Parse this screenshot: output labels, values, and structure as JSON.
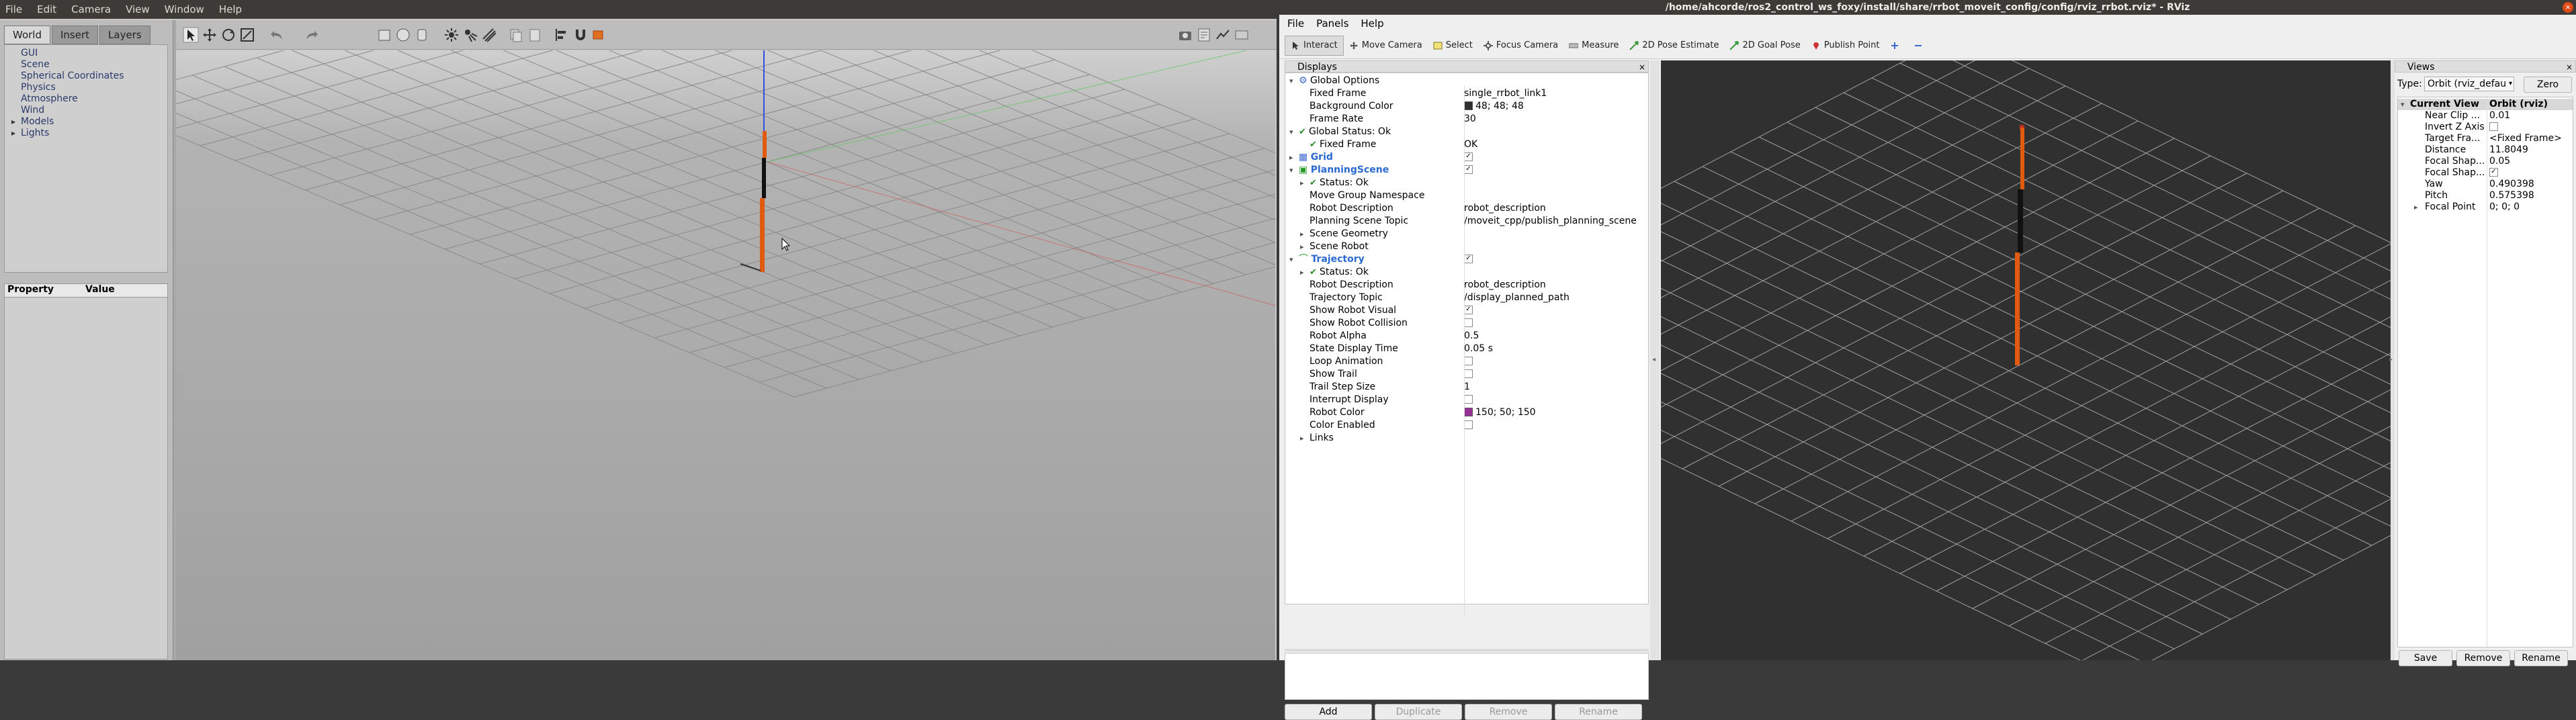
{
  "gazebo": {
    "menu": [
      "File",
      "Edit",
      "Camera",
      "View",
      "Window",
      "Help"
    ],
    "tabs": [
      "World",
      "Insert",
      "Layers"
    ],
    "tree_items": [
      {
        "label": "GUI",
        "expandable": false
      },
      {
        "label": "Scene",
        "expandable": false
      },
      {
        "label": "Spherical Coordinates",
        "expandable": false
      },
      {
        "label": "Physics",
        "expandable": false
      },
      {
        "label": "Atmosphere",
        "expandable": false
      },
      {
        "label": "Wind",
        "expandable": false
      },
      {
        "label": "Models",
        "expandable": true
      },
      {
        "label": "Lights",
        "expandable": true
      }
    ],
    "property_header": {
      "property": "Property",
      "value": "Value"
    }
  },
  "rviz": {
    "title": "/home/ahcorde/ros2_control_ws_foxy/install/share/rrbot_moveit_config/config/rviz_rrbot.rviz* - RViz",
    "menu": [
      "File",
      "Panels",
      "Help"
    ],
    "tools": [
      {
        "label": "Interact",
        "icon": "interact-icon",
        "active": true
      },
      {
        "label": "Move Camera",
        "icon": "move-camera-icon",
        "active": false
      },
      {
        "label": "Select",
        "icon": "select-icon",
        "active": false
      },
      {
        "label": "Focus Camera",
        "icon": "focus-camera-icon",
        "active": false
      },
      {
        "label": "Measure",
        "icon": "measure-icon",
        "active": false
      },
      {
        "label": "2D Pose Estimate",
        "icon": "pose-estimate-icon",
        "active": false
      },
      {
        "label": "2D Goal Pose",
        "icon": "goal-pose-icon",
        "active": false
      },
      {
        "label": "Publish Point",
        "icon": "publish-point-icon",
        "active": false
      }
    ],
    "displays": {
      "title": "Displays",
      "rows": [
        {
          "indent": 0,
          "expander": "▾",
          "icon": "gear",
          "label": "Global Options",
          "value": ""
        },
        {
          "indent": 1,
          "label": "Fixed Frame",
          "value": "single_rrbot_link1"
        },
        {
          "indent": 1,
          "label": "Background Color",
          "value": "48; 48; 48",
          "swatch": "#303030"
        },
        {
          "indent": 1,
          "label": "Frame Rate",
          "value": "30"
        },
        {
          "indent": 0,
          "expander": "▾",
          "tick": true,
          "label": "Global Status: Ok",
          "value": ""
        },
        {
          "indent": 1,
          "tick": true,
          "label": "Fixed Frame",
          "value": "OK"
        },
        {
          "indent": 0,
          "expander": "▸",
          "icon": "grid",
          "label": "Grid",
          "value": "",
          "check": true,
          "highlight": true
        },
        {
          "indent": 0,
          "expander": "▾",
          "icon": "scene",
          "label": "PlanningScene",
          "value": "",
          "check": true,
          "highlight": true
        },
        {
          "indent": 1,
          "expander": "▸",
          "tick": true,
          "label": "Status: Ok",
          "value": ""
        },
        {
          "indent": 1,
          "label": "Move Group Namespace",
          "value": ""
        },
        {
          "indent": 1,
          "label": "Robot Description",
          "value": "robot_description"
        },
        {
          "indent": 1,
          "label": "Planning Scene Topic",
          "value": "/moveit_cpp/publish_planning_scene"
        },
        {
          "indent": 1,
          "expander": "▸",
          "label": "Scene Geometry",
          "value": ""
        },
        {
          "indent": 1,
          "expander": "▸",
          "label": "Scene Robot",
          "value": ""
        },
        {
          "indent": 0,
          "expander": "▾",
          "icon": "trajectory",
          "label": "Trajectory",
          "value": "",
          "check": true,
          "highlight": true
        },
        {
          "indent": 1,
          "expander": "▸",
          "tick": true,
          "label": "Status: Ok",
          "value": ""
        },
        {
          "indent": 1,
          "label": "Robot Description",
          "value": "robot_description"
        },
        {
          "indent": 1,
          "label": "Trajectory Topic",
          "value": "/display_planned_path"
        },
        {
          "indent": 1,
          "label": "Show Robot Visual",
          "value": "",
          "check": true
        },
        {
          "indent": 1,
          "label": "Show Robot Collision",
          "value": "",
          "check": false
        },
        {
          "indent": 1,
          "label": "Robot Alpha",
          "value": "0.5"
        },
        {
          "indent": 1,
          "label": "State Display Time",
          "value": "0.05 s"
        },
        {
          "indent": 1,
          "label": "Loop Animation",
          "value": "",
          "check": false
        },
        {
          "indent": 1,
          "label": "Show Trail",
          "value": "",
          "check": false
        },
        {
          "indent": 1,
          "label": "Trail Step Size",
          "value": "1"
        },
        {
          "indent": 1,
          "label": "Interrupt Display",
          "value": "",
          "check": false
        },
        {
          "indent": 1,
          "label": "Robot Color",
          "value": "150; 50; 150",
          "swatch": "#963296"
        },
        {
          "indent": 1,
          "label": "Color Enabled",
          "value": "",
          "check": false
        },
        {
          "indent": 1,
          "expander": "▸",
          "label": "Links",
          "value": ""
        }
      ],
      "buttons": [
        "Add",
        "Duplicate",
        "Remove",
        "Rename"
      ]
    },
    "views": {
      "title": "Views",
      "type_label": "Type:",
      "type_value": "Orbit (rviz_defau",
      "zero_label": "Zero",
      "rows": [
        {
          "label": "Current View",
          "value": "Orbit (rviz)",
          "header": true
        },
        {
          "label": "Near Clip ...",
          "value": "0.01"
        },
        {
          "label": "Invert Z Axis",
          "value": "",
          "check": false
        },
        {
          "label": "Target Fra...",
          "value": "<Fixed Frame>"
        },
        {
          "label": "Distance",
          "value": "11.8049"
        },
        {
          "label": "Focal Shap...",
          "value": "0.05"
        },
        {
          "label": "Focal Shap...",
          "value": "",
          "check": true
        },
        {
          "label": "Yaw",
          "value": "0.490398"
        },
        {
          "label": "Pitch",
          "value": "0.575398"
        },
        {
          "label": "Focal Point",
          "value": "0; 0; 0",
          "expander": true
        }
      ],
      "buttons": [
        "Save",
        "Remove",
        "Rename"
      ]
    }
  },
  "colors": {
    "robot_orange": "#e05a10",
    "rviz_bg": "#303030",
    "gazebo_sky": "#a6a6a6"
  }
}
